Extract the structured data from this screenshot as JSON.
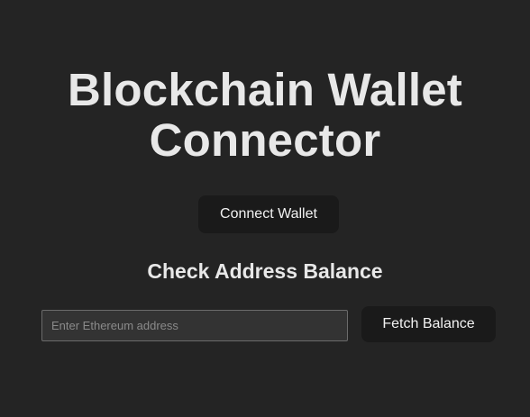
{
  "header": {
    "title_line1": "Blockchain Wallet",
    "title_line2": "Connector"
  },
  "wallet": {
    "connect_label": "Connect Wallet"
  },
  "balance": {
    "section_title": "Check Address Balance",
    "address_placeholder": "Enter Ethereum address",
    "address_value": "",
    "fetch_label": "Fetch Balance"
  },
  "colors": {
    "background": "#242424",
    "button_bg": "#1a1a1a",
    "text": "#e8e8e8",
    "input_bg": "#333333",
    "input_border": "#6b6b6b"
  }
}
